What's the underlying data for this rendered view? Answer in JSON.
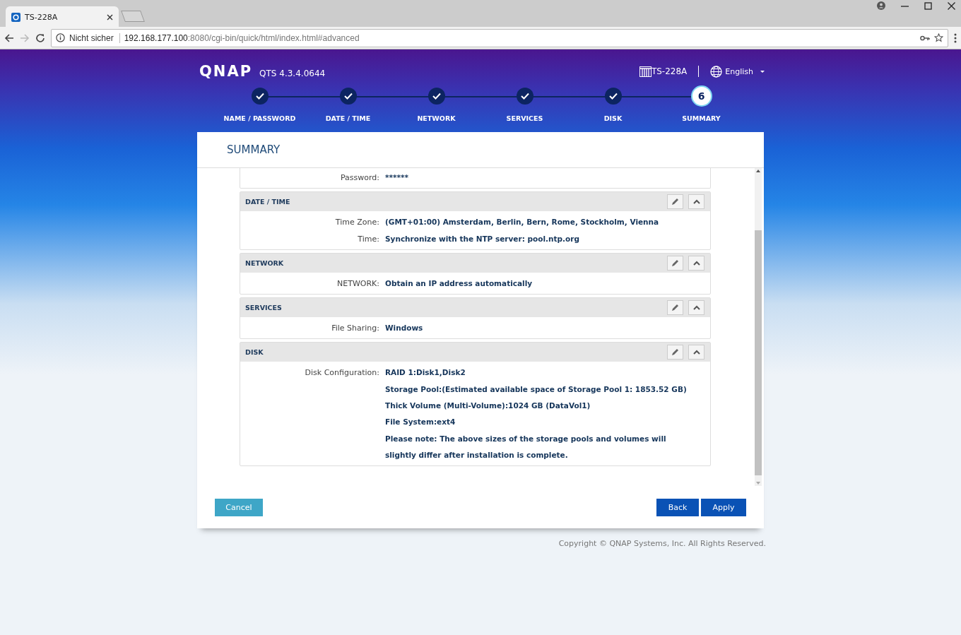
{
  "browser": {
    "tab": {
      "title": "TS-228A"
    },
    "security": "Nicht sicher",
    "url_host": "192.168.177.100",
    "url_rest": ":8080/cgi-bin/quick/html/index.html#advanced"
  },
  "header": {
    "logo": "QNAP",
    "version": "QTS 4.3.4.0644",
    "device": "TS-228A",
    "language": "English"
  },
  "steps": [
    {
      "label": "NAME / PASSWORD",
      "kind": "done"
    },
    {
      "label": "DATE / TIME",
      "kind": "done"
    },
    {
      "label": "NETWORK",
      "kind": "done"
    },
    {
      "label": "SERVICES",
      "kind": "done"
    },
    {
      "label": "DISK",
      "kind": "done"
    },
    {
      "label": "SUMMARY",
      "kind": "current",
      "number": "6"
    }
  ],
  "summary": {
    "title": "SUMMARY",
    "sections": [
      {
        "rows": [
          {
            "label": "Password:",
            "values": [
              "******"
            ]
          }
        ]
      },
      {
        "title": "DATE / TIME",
        "rows": [
          {
            "label": "Time Zone:",
            "values": [
              "(GMT+01:00) Amsterdam, Berlin, Bern, Rome, Stockholm, Vienna"
            ]
          },
          {
            "label": "Time:",
            "values": [
              "Synchronize with the NTP server: pool.ntp.org"
            ]
          }
        ]
      },
      {
        "title": "NETWORK",
        "rows": [
          {
            "label": "NETWORK:",
            "values": [
              "Obtain an IP address automatically"
            ]
          }
        ]
      },
      {
        "title": "SERVICES",
        "rows": [
          {
            "label": "File Sharing:",
            "values": [
              "Windows"
            ]
          }
        ]
      },
      {
        "title": "DISK",
        "rows": [
          {
            "label": "Disk Configuration:",
            "values": [
              "RAID 1:Disk1,Disk2",
              "Storage Pool:(Estimated available space of Storage Pool 1: 1853.52 GB)",
              "Thick Volume (Multi-Volume):1024 GB (DataVol1)",
              "File System:ext4",
              "Please note: The above sizes of the storage pools and volumes will slightly differ after installation is complete."
            ]
          }
        ]
      }
    ]
  },
  "buttons": {
    "cancel": "Cancel",
    "back": "Back",
    "apply": "Apply"
  },
  "copyright": "Copyright © QNAP Systems, Inc. All Rights Reserved."
}
